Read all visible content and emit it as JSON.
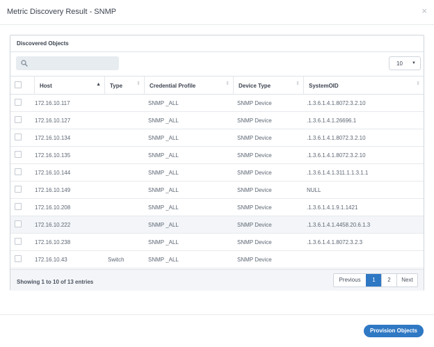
{
  "modal": {
    "title": "Metric Discovery Result - SNMP",
    "close_glyph": "×"
  },
  "panel": {
    "title": "Discovered Objects",
    "search": {
      "value": "",
      "placeholder": ""
    },
    "page_size": "10"
  },
  "table": {
    "columns": [
      "Host",
      "Type",
      "Credential Profile",
      "Device Type",
      "SystemOID"
    ],
    "sorted_column": "Host",
    "rows": [
      {
        "host": "172.16.10.117",
        "type": "",
        "credential": "SNMP _ALL",
        "device_type": "SNMP Device",
        "oid": ".1.3.6.1.4.1.8072.3.2.10"
      },
      {
        "host": "172.16.10.127",
        "type": "",
        "credential": "SNMP _ALL",
        "device_type": "SNMP Device",
        "oid": ".1.3.6.1.4.1.26696.1"
      },
      {
        "host": "172.16.10.134",
        "type": "",
        "credential": "SNMP _ALL",
        "device_type": "SNMP Device",
        "oid": ".1.3.6.1.4.1.8072.3.2.10"
      },
      {
        "host": "172.16.10.135",
        "type": "",
        "credential": "SNMP _ALL",
        "device_type": "SNMP Device",
        "oid": ".1.3.6.1.4.1.8072.3.2.10"
      },
      {
        "host": "172.16.10.144",
        "type": "",
        "credential": "SNMP _ALL",
        "device_type": "SNMP Device",
        "oid": ".1.3.6.1.4.1.311.1.1.3.1.1"
      },
      {
        "host": "172.16.10.149",
        "type": "",
        "credential": "SNMP _ALL",
        "device_type": "SNMP Device",
        "oid": "NULL"
      },
      {
        "host": "172.16.10.208",
        "type": "",
        "credential": "SNMP _ALL",
        "device_type": "SNMP Device",
        "oid": ".1.3.6.1.4.1.9.1.1421"
      },
      {
        "host": "172.16.10.222",
        "type": "",
        "credential": "SNMP _ALL",
        "device_type": "SNMP Device",
        "oid": ".1.3.6.1.4.1.4458.20.6.1.3"
      },
      {
        "host": "172.16.10.238",
        "type": "",
        "credential": "SNMP _ALL",
        "device_type": "SNMP Device",
        "oid": ".1.3.6.1.4.1.8072.3.2.3"
      },
      {
        "host": "172.16.10.43",
        "type": "Switch",
        "credential": "SNMP _ALL",
        "device_type": "SNMP Device",
        "oid": ""
      }
    ]
  },
  "footer": {
    "entries_text": "Showing 1 to 10 of 13 entries",
    "pagination": {
      "previous": "Previous",
      "pages": [
        "1",
        "2"
      ],
      "active_page": "1",
      "next": "Next"
    }
  },
  "actions": {
    "provision_label": "Provision Objects"
  },
  "colors": {
    "accent": "#2f78c4",
    "row_alt": "#f3f5f8",
    "border": "#cfd5dc"
  }
}
